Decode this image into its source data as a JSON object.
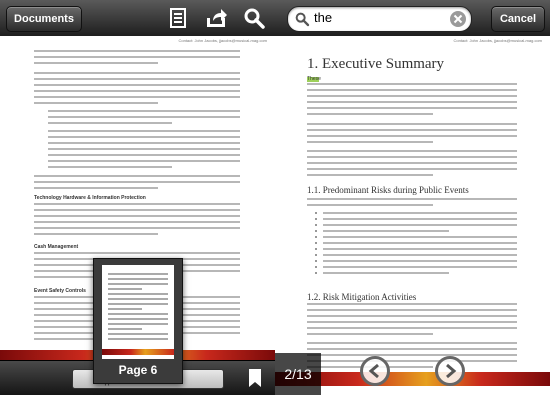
{
  "left": {
    "documents_button": "Documents",
    "contact": "Contact: John Jacobs, jjacobs@musical-mag.com",
    "sections": {
      "tech": "Technology Hardware & Information Protection",
      "cash": "Cash Management",
      "event": "Event Safety Controls"
    },
    "page_label": "Page 6",
    "slider_handle": "||"
  },
  "right": {
    "search_value": "the",
    "cancel_button": "Cancel",
    "contact": "Contact: John Jacobs, jjacobs@musical-mag.com",
    "heading": "1.  Executive Summary",
    "first_word": "These",
    "subheading_1": "1.1.  Predominant Risks during Public Events",
    "subheading_2": "1.2.  Risk Mitigation Activities",
    "page_counter": "2/13"
  },
  "colors": {
    "highlight": "#9ed05a",
    "bar_dark": "#1e1e1e",
    "footer_red": "#c8281c"
  },
  "icons": [
    "book-icon",
    "share-icon",
    "search-icon",
    "clear-icon",
    "bookmark-icon",
    "arrow-left-icon",
    "arrow-right-icon"
  ]
}
